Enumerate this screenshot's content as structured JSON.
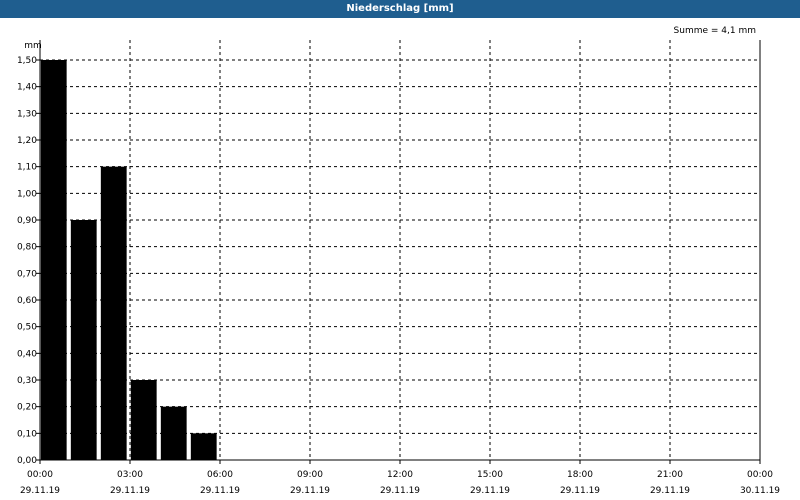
{
  "window": {
    "title": "Niederschlag [mm]"
  },
  "summary": {
    "text": "Summe = 4,1 mm"
  },
  "chart_data": {
    "type": "bar",
    "title": "Niederschlag [mm]",
    "ylabel": "mm",
    "ylim": [
      0,
      1.5
    ],
    "y_ticks": [
      "0,00",
      "0,10",
      "0,20",
      "0,30",
      "0,40",
      "0,50",
      "0,60",
      "0,70",
      "0,80",
      "0,90",
      "1,00",
      "1,10",
      "1,20",
      "1,30",
      "1,40",
      "1,50"
    ],
    "x_range_hours": [
      0,
      24
    ],
    "x_ticks": [
      {
        "time": "00:00",
        "date": "29.11.19"
      },
      {
        "time": "03:00",
        "date": "29.11.19"
      },
      {
        "time": "06:00",
        "date": "29.11.19"
      },
      {
        "time": "09:00",
        "date": "29.11.19"
      },
      {
        "time": "12:00",
        "date": "29.11.19"
      },
      {
        "time": "15:00",
        "date": "29.11.19"
      },
      {
        "time": "18:00",
        "date": "29.11.19"
      },
      {
        "time": "21:00",
        "date": "29.11.19"
      },
      {
        "time": "00:00",
        "date": "30.11.19"
      }
    ],
    "series": [
      {
        "bars": [
          {
            "start": "00:00",
            "end": "01:00",
            "value": 1.5
          },
          {
            "start": "01:00",
            "end": "02:00",
            "value": 0.9
          },
          {
            "start": "02:00",
            "end": "03:00",
            "value": 1.1
          },
          {
            "start": "03:00",
            "end": "04:00",
            "value": 0.3
          },
          {
            "start": "04:00",
            "end": "05:00",
            "value": 0.2
          },
          {
            "start": "05:00",
            "end": "06:00",
            "value": 0.1
          }
        ]
      }
    ],
    "grid": true,
    "colors": {
      "bar": "#000000",
      "title_bar": "#1f5e8f"
    }
  }
}
